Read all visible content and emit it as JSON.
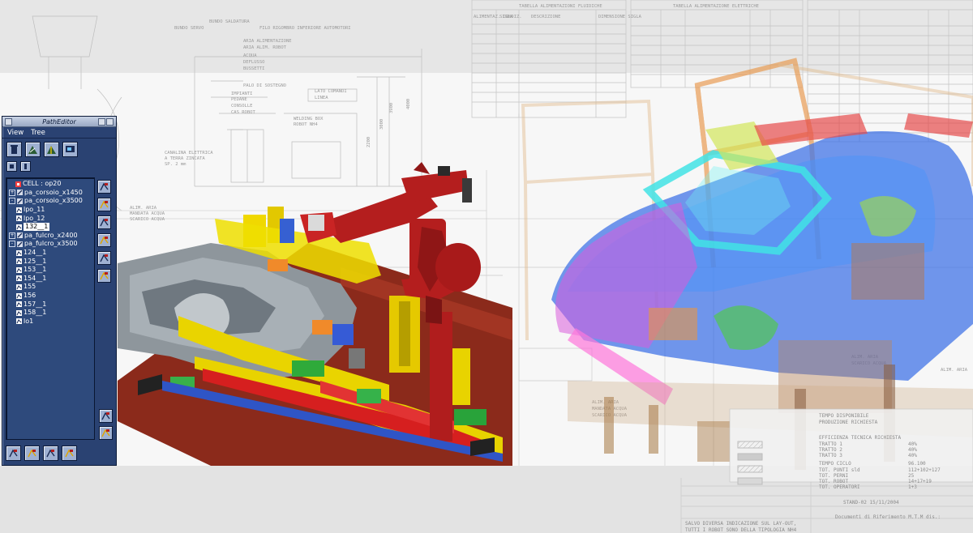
{
  "window": {
    "title": "PathEditor",
    "menu": [
      "View",
      "Tree"
    ]
  },
  "tree": [
    {
      "label": "CELL : op20",
      "depth": 0,
      "expander": "",
      "icon": "cell-icon"
    },
    {
      "label": "pa_corsoio_x1450",
      "depth": 0,
      "expander": "+",
      "icon": "path-icon"
    },
    {
      "label": "pa_corsoio_x3500",
      "depth": 0,
      "expander": "-",
      "icon": "path-icon"
    },
    {
      "label": "lpo_11",
      "depth": 1,
      "expander": "",
      "icon": "location-icon"
    },
    {
      "label": "lpo_12",
      "depth": 1,
      "expander": "",
      "icon": "location-icon"
    },
    {
      "label": "132__1",
      "depth": 1,
      "expander": "",
      "icon": "location-icon",
      "selected": true
    },
    {
      "label": "pa_fulcro_x2400",
      "depth": 0,
      "expander": "+",
      "icon": "path-icon"
    },
    {
      "label": "pa_fulcro_x3500",
      "depth": 0,
      "expander": "-",
      "icon": "path-icon"
    },
    {
      "label": "124__1",
      "depth": 1,
      "expander": "",
      "icon": "location-icon"
    },
    {
      "label": "125__1",
      "depth": 1,
      "expander": "",
      "icon": "location-icon"
    },
    {
      "label": "153__1",
      "depth": 1,
      "expander": "",
      "icon": "location-icon"
    },
    {
      "label": "154__1",
      "depth": 1,
      "expander": "",
      "icon": "location-icon"
    },
    {
      "label": "155",
      "depth": 1,
      "expander": "",
      "icon": "location-icon"
    },
    {
      "label": "156",
      "depth": 1,
      "expander": "",
      "icon": "location-icon"
    },
    {
      "label": "157__1",
      "depth": 1,
      "expander": "",
      "icon": "location-icon"
    },
    {
      "label": "158__1",
      "depth": 1,
      "expander": "",
      "icon": "location-icon"
    },
    {
      "label": "lo1",
      "depth": 1,
      "expander": "",
      "icon": "location-icon"
    }
  ],
  "toolbar_icons": [
    "trash-icon",
    "path-add-icon",
    "path-flip-icon",
    "screen-icon"
  ],
  "small_toolbar_icons": [
    "small-a-icon",
    "small-b-icon"
  ],
  "side_icons": [
    "edit-location-icon",
    "add-location-icon",
    "insert-location-icon",
    "move-location-icon",
    "teach-icon",
    "attributes-icon",
    "copy-icon",
    "paste-icon"
  ],
  "bottom_icons": [
    "play-path-icon",
    "reverse-path-icon",
    "step-path-icon",
    "stop-path-icon"
  ],
  "drawing": {
    "labels_left": [
      "BUNDO SALDATURA",
      "BUNDO SERVO",
      "FILO RIGOMBRO INFERIORE AUTOMOTORI",
      "ARIA ALIMENTAZIONE",
      "ARIA ALIM. ROBOT",
      "ACQUA",
      "DEFLUSSO",
      "BUSSETTI",
      "PALO DI SOSTEGNO",
      "IMPIANTI",
      "PEDANE",
      "CONSOLLE",
      "CAS ROBOT",
      "LATO COMANDI",
      "LINEA",
      "WELDING BOX",
      "ROBOT NH4",
      "CANALINA ELETTRICA",
      "A TERRA ZINCATA",
      "SP. 2 mm",
      "ALIM. ARIA",
      "MANDATA ACQUA",
      "SCARICO ACQUA"
    ],
    "labels_right": [
      "ALIM. ARIA",
      "SCARICO ACQUA",
      "ALIM. ARIA",
      "MANDATA ACQUA",
      "SCARICO ACQUA",
      "ALIM. ARIA"
    ],
    "table_titles": [
      "TABELLA ALIMENTAZIONI FLUIDICHE",
      "TABELLA ALIMENTAZIONE ELETTRICHE"
    ],
    "table_headers": [
      "ALIMENTAZ. CONDIZ.",
      "SIGLA",
      "DESCRIZIONE",
      "DIMENSIONE SIGLA"
    ],
    "dims": [
      "3900",
      "3000",
      "2200",
      "4000"
    ],
    "stamp": [
      "TEMPO DISPONIBILE",
      "PRODUZIONE RICHIESTA",
      "EFFICIENZA TECNICA RICHIESTA",
      "TRATTO 1",
      "TRATTO 2",
      "TRATTO 3",
      "TEMPO CICLO",
      "TOT. PUNTI sld",
      "TOT. PERNI",
      "TOT. ROBOT",
      "TOT. OPERATORI",
      "STAND-02 15/11/2004",
      "Documenti di Riferimento M.T.M dis.:",
      "SALVO DIVERSA INDICAZIONE SUL LAY-OUT,",
      "TUTTI I ROBOT SONO DELLA TIPOLOGIA NH4"
    ],
    "stamp_values": [
      "40%",
      "40%",
      "40%",
      "96.100",
      "112+102+127",
      "25",
      "14+17+19",
      "1+3"
    ]
  }
}
